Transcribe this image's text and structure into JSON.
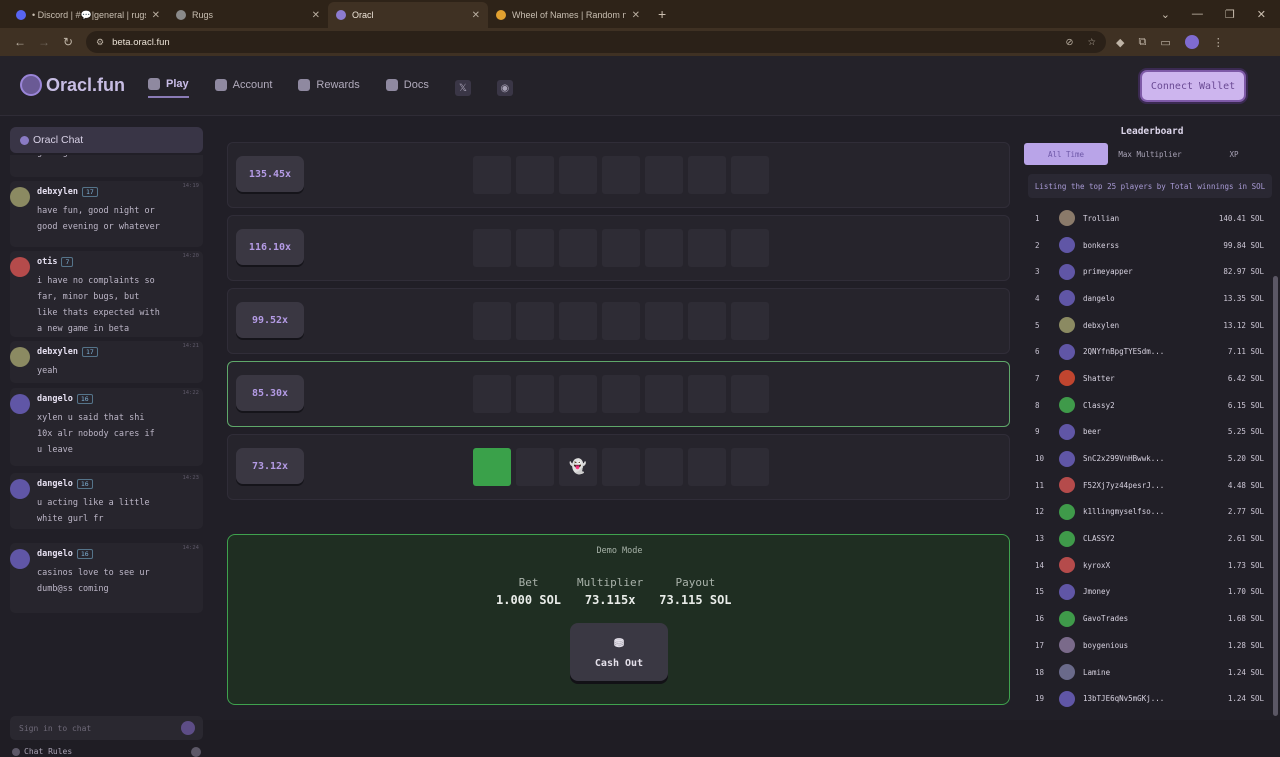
{
  "browser": {
    "tabs": [
      {
        "title": "• Discord | #💬|general | rugs.",
        "favicon_color": "#5865f2",
        "active": false
      },
      {
        "title": "Rugs",
        "favicon_color": "#8a8a8a",
        "active": false
      },
      {
        "title": "Oracl",
        "favicon_color": "#8c7bd0",
        "active": true
      },
      {
        "title": "Wheel of Names | Random nam",
        "favicon_color": "#e0a030",
        "active": false
      }
    ],
    "new_tab": "+",
    "url": "beta.oracl.fun"
  },
  "header": {
    "logo": "Oracl.fun",
    "nav": [
      {
        "label": "Play",
        "active": true
      },
      {
        "label": "Account",
        "active": false
      },
      {
        "label": "Rewards",
        "active": false
      },
      {
        "label": "Docs",
        "active": false
      }
    ],
    "social": [
      "𝕏",
      "◉"
    ],
    "connect_wallet": "Connect Wallet"
  },
  "chat": {
    "title": "Oracl Chat",
    "messages": [
      {
        "user": "",
        "level": "",
        "time": "",
        "body": "good game",
        "avatar_color": "#6e6880"
      },
      {
        "user": "debxylen",
        "level": "17",
        "time": "14:19",
        "body": "have fun, good night or\ngood evening or whatever",
        "avatar_color": "#8b8a62"
      },
      {
        "user": "otis",
        "level": "7",
        "time": "14:20",
        "body": "i have no complaints so\nfar, minor bugs, but\nlike thats expected with\na new game in beta",
        "avatar_color": "#b54b4b"
      },
      {
        "user": "debxylen",
        "level": "17",
        "time": "14:21",
        "body": "yeah",
        "avatar_color": "#8b8a62"
      },
      {
        "user": "dangelo",
        "level": "16",
        "time": "14:22",
        "body": "xylen u said that shi\n10x alr nobody cares if\nu leave",
        "avatar_color": "#6056a6"
      },
      {
        "user": "dangelo",
        "level": "16",
        "time": "14:23",
        "body": "u acting like a little\nwhite gurl fr",
        "avatar_color": "#6056a6"
      },
      {
        "user": "dangelo",
        "level": "16",
        "time": "14:24",
        "body": "casinos love to see ur\ndumb@ss coming",
        "avatar_color": "#6056a6"
      }
    ],
    "input_placeholder": "Sign in to chat",
    "rules": "Chat Rules"
  },
  "board": {
    "rows": [
      {
        "multiplier": "135.45x",
        "current": false,
        "tiles": [
          "",
          "",
          "",
          "",
          "",
          "",
          ""
        ]
      },
      {
        "multiplier": "116.10x",
        "current": false,
        "tiles": [
          "",
          "",
          "",
          "",
          "",
          "",
          ""
        ]
      },
      {
        "multiplier": "99.52x",
        "current": false,
        "tiles": [
          "",
          "",
          "",
          "",
          "",
          "",
          ""
        ]
      },
      {
        "multiplier": "85.30x",
        "current": true,
        "tiles": [
          "",
          "",
          "",
          "",
          "",
          "",
          ""
        ]
      },
      {
        "multiplier": "73.12x",
        "current": false,
        "tiles": [
          "green",
          "",
          "ghost",
          "",
          "",
          "",
          ""
        ]
      }
    ]
  },
  "cashout": {
    "mode": "Demo Mode",
    "bet_label": "Bet",
    "bet_value": "1.000 SOL",
    "multiplier_label": "Multiplier",
    "multiplier_value": "73.115x",
    "payout_label": "Payout",
    "payout_value": "73.115 SOL",
    "button": "Cash Out"
  },
  "leaderboard": {
    "title": "Leaderboard",
    "tabs": [
      {
        "label": "All Time",
        "active": true
      },
      {
        "label": "Max Multiplier",
        "active": false
      },
      {
        "label": "XP",
        "active": false
      }
    ],
    "subtitle": "Listing the top 25 players by Total winnings in SOL",
    "rows": [
      {
        "rank": "1",
        "name": "Trollian",
        "amount": "140.41 SOL",
        "avatar_color": "#8a7a6a"
      },
      {
        "rank": "2",
        "name": "bonkerss",
        "amount": "99.84 SOL",
        "avatar_color": "#6056a6"
      },
      {
        "rank": "3",
        "name": "primeyapper",
        "amount": "82.97 SOL",
        "avatar_color": "#6056a6"
      },
      {
        "rank": "4",
        "name": "dangelo",
        "amount": "13.35 SOL",
        "avatar_color": "#6056a6"
      },
      {
        "rank": "5",
        "name": "debxylen",
        "amount": "13.12 SOL",
        "avatar_color": "#8b8a62"
      },
      {
        "rank": "6",
        "name": "2QNYfnBpgTYESdm...",
        "amount": "7.11 SOL",
        "avatar_color": "#6056a6"
      },
      {
        "rank": "7",
        "name": "Shatter",
        "amount": "6.42 SOL",
        "avatar_color": "#c0452f"
      },
      {
        "rank": "8",
        "name": "Classy2",
        "amount": "6.15 SOL",
        "avatar_color": "#3f9a4a"
      },
      {
        "rank": "9",
        "name": "beer",
        "amount": "5.25 SOL",
        "avatar_color": "#6056a6"
      },
      {
        "rank": "10",
        "name": "SnC2x299VnHBwwk...",
        "amount": "5.20 SOL",
        "avatar_color": "#6056a6"
      },
      {
        "rank": "11",
        "name": "F52Xj7yz44pesrJ...",
        "amount": "4.48 SOL",
        "avatar_color": "#b54b4b"
      },
      {
        "rank": "12",
        "name": "k1llingmyselfso...",
        "amount": "2.77 SOL",
        "avatar_color": "#3f9a4a"
      },
      {
        "rank": "13",
        "name": "CLASSY2",
        "amount": "2.61 SOL",
        "avatar_color": "#3f9a4a"
      },
      {
        "rank": "14",
        "name": "kyroxX",
        "amount": "1.73 SOL",
        "avatar_color": "#b54b4b"
      },
      {
        "rank": "15",
        "name": "Jmoney",
        "amount": "1.70 SOL",
        "avatar_color": "#6056a6"
      },
      {
        "rank": "16",
        "name": "GavoTrades",
        "amount": "1.68 SOL",
        "avatar_color": "#3f9a4a"
      },
      {
        "rank": "17",
        "name": "boygenious",
        "amount": "1.28 SOL",
        "avatar_color": "#7a6a8a"
      },
      {
        "rank": "18",
        "name": "Lamine",
        "amount": "1.24 SOL",
        "avatar_color": "#6a6a8a"
      },
      {
        "rank": "19",
        "name": "13bTJE6qNv5mGKj...",
        "amount": "1.24 SOL",
        "avatar_color": "#6056a6"
      }
    ]
  }
}
